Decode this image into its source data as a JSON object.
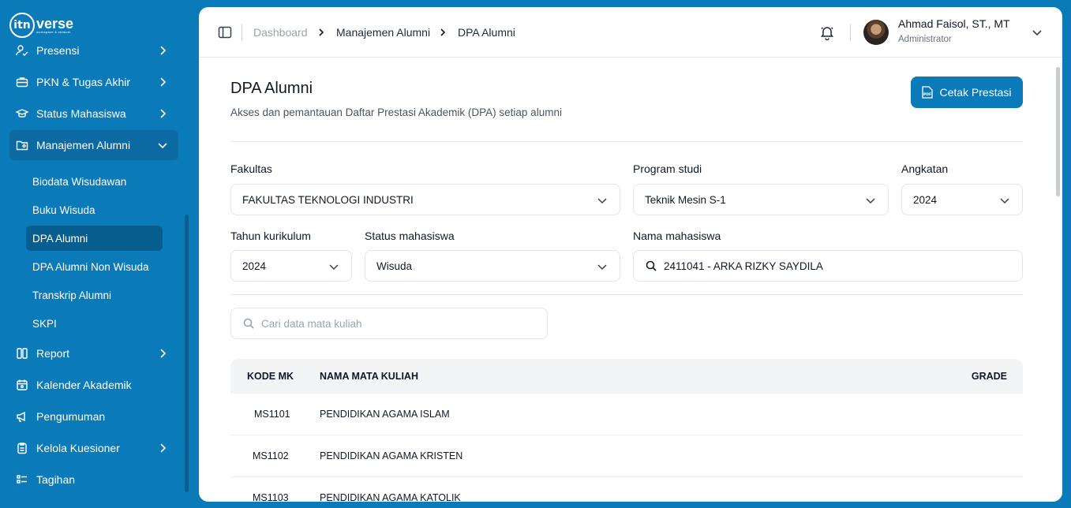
{
  "brand": {
    "logo_text": "verse",
    "logo_sub": "workspace & network",
    "logo_mark": "itn"
  },
  "sidebar": {
    "items": [
      {
        "label": "Presensi",
        "icon": "user-check-icon"
      },
      {
        "label": "PKN & Tugas Akhir",
        "icon": "briefcase-icon"
      },
      {
        "label": "Status Mahasiswa",
        "icon": "graduation-cap-icon"
      },
      {
        "label": "Manajemen Alumni",
        "icon": "folder-user-icon"
      },
      {
        "label": "Report",
        "icon": "report-icon"
      },
      {
        "label": "Kalender Akademik",
        "icon": "calendar-icon"
      },
      {
        "label": "Pengumuman",
        "icon": "megaphone-icon"
      },
      {
        "label": "Kelola Kuesioner",
        "icon": "clipboard-icon"
      },
      {
        "label": "Tagihan",
        "icon": "list-icon"
      }
    ],
    "sub_items": [
      "Biodata Wisudawan",
      "Buku Wisuda",
      "DPA Alumni",
      "DPA Alumni Non Wisuda",
      "Transkrip Alumni",
      "SKPI"
    ]
  },
  "header": {
    "breadcrumb": [
      "Dashboard",
      "Manajemen Alumni",
      "DPA Alumni"
    ],
    "user_name": "Ahmad Faisol, ST., MT",
    "user_role": "Administrator"
  },
  "page": {
    "title": "DPA Alumni",
    "subtitle": "Akses dan pemantauan Daftar Prestasi Akademik (DPA) setiap alumni",
    "print_button": "Cetak Prestasi",
    "pdf_badge": "PDF"
  },
  "filters": {
    "fakultas": {
      "label": "Fakultas",
      "value": "FAKULTAS TEKNOLOGI INDUSTRI"
    },
    "prodi": {
      "label": "Program studi",
      "value": "Teknik Mesin S-1"
    },
    "angkatan": {
      "label": "Angkatan",
      "value": "2024"
    },
    "kurikulum": {
      "label": "Tahun kurikulum",
      "value": "2024"
    },
    "status": {
      "label": "Status mahasiswa",
      "value": "Wisuda"
    },
    "nama": {
      "label": "Nama mahasiswa",
      "value": "2411041 - ARKA RIZKY SAYDILA"
    }
  },
  "search": {
    "placeholder": "Cari data mata kuliah"
  },
  "table": {
    "headers": [
      "KODE MK",
      "NAMA MATA KULIAH",
      "GRADE"
    ],
    "rows": [
      {
        "kode": "MS1101",
        "nama": "PENDIDIKAN AGAMA ISLAM",
        "grade": ""
      },
      {
        "kode": "MS1102",
        "nama": "PENDIDIKAN AGAMA KRISTEN",
        "grade": ""
      },
      {
        "kode": "MS1103",
        "nama": "PENDIDIKAN AGAMA KATOLIK",
        "grade": ""
      }
    ]
  },
  "colors": {
    "primary": "#0a7ab8",
    "sidebar_active": "#0b6aa1"
  }
}
